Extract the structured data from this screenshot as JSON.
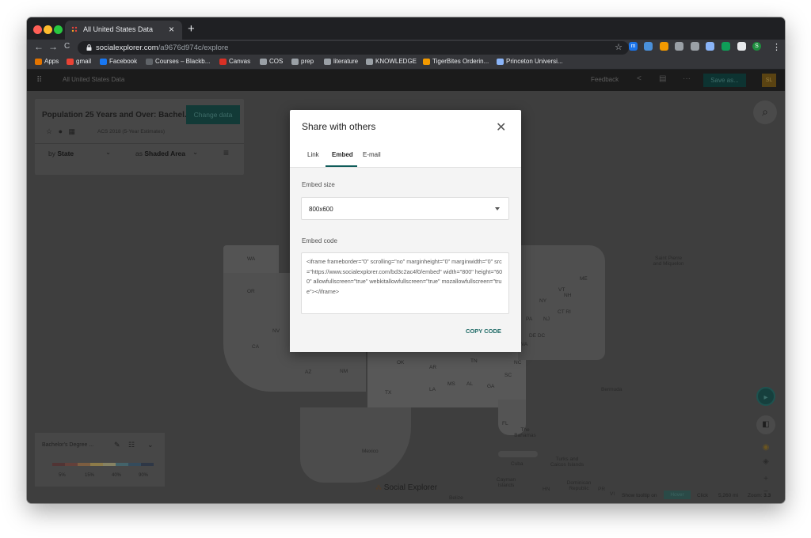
{
  "browser": {
    "tab_title": "All United States Data",
    "tab_close": "×",
    "new_tab": "+",
    "url_host": "socialexplorer.com",
    "url_path": "/a9676d974c/explore",
    "nav": {
      "back": "←",
      "forward": "→",
      "reload": "C"
    },
    "star": "☆",
    "traffic_colors": [
      "#ff5f57",
      "#febc2e",
      "#28c840"
    ],
    "extensions": [
      {
        "name": "m-extension-icon",
        "color": "#1a73e8",
        "glyph": "m"
      },
      {
        "name": "bookmark-extension-icon",
        "color": "#4a90d9",
        "glyph": ""
      },
      {
        "name": "calendar-extension-icon",
        "color": "#f29900",
        "glyph": ""
      },
      {
        "name": "camera-extension-icon",
        "color": "#9aa0a6",
        "glyph": ""
      },
      {
        "name": "puzzle-extension-icon",
        "color": "#9aa0a6",
        "glyph": ""
      },
      {
        "name": "lookup-extension-icon",
        "color": "#8ab4f8",
        "glyph": ""
      },
      {
        "name": "image-extension-icon",
        "color": "#0f9d58",
        "glyph": ""
      },
      {
        "name": "extensions-icon",
        "color": "#e8eaed",
        "glyph": ""
      },
      {
        "name": "profile-avatar-icon",
        "color": "#1e8e3e",
        "glyph": "S"
      }
    ],
    "menu": "⋮",
    "bookmarks": [
      {
        "label": "Apps",
        "color": "#e37400"
      },
      {
        "label": "gmail",
        "color": "#ea4335"
      },
      {
        "label": "Facebook",
        "color": "#1877f2"
      },
      {
        "label": "Courses – Blackb...",
        "color": "#5f6368"
      },
      {
        "label": "Canvas",
        "color": "#d93025"
      },
      {
        "label": "COS",
        "color": "#9aa0a6"
      },
      {
        "label": "prep",
        "color": "#9aa0a6"
      },
      {
        "label": "literature",
        "color": "#9aa0a6"
      },
      {
        "label": "KNOWLEDGE",
        "color": "#9aa0a6"
      },
      {
        "label": "TigerBites Orderin...",
        "color": "#f29900"
      },
      {
        "label": "Princeton Universi...",
        "color": "#8ab4f8"
      }
    ]
  },
  "app": {
    "title": "All United States Data",
    "feedback": "Feedback",
    "save": "Save as...",
    "user_initials": "SL"
  },
  "panel": {
    "title": "Population 25 Years and Over: Bachel...",
    "change_data": "Change data",
    "survey": "ACS 2018 (5-Year Estimates)",
    "by_prefix": "by",
    "by_value": "State",
    "as_prefix": "as",
    "as_value": "Shaded Area"
  },
  "legend": {
    "title": "Bachelor's Degree ...",
    "ticks": [
      "5%",
      "15%",
      "40%",
      "90%"
    ],
    "colors": [
      "#5a2424",
      "#7a3b30",
      "#a8703a",
      "#c6a64a",
      "#b9b37a",
      "#3f7a86",
      "#244f6e",
      "#1a2a45"
    ]
  },
  "map": {
    "labels": [
      "WA",
      "OR",
      "CA",
      "NV",
      "AZ",
      "NM",
      "TX",
      "OK",
      "AR",
      "LA",
      "MS",
      "AL",
      "GA",
      "TN",
      "NC",
      "SC",
      "FL",
      "VA",
      "PA",
      "NJ",
      "NY",
      "VT",
      "NH",
      "ME",
      "CT RI",
      "DE DC",
      "The Bahamas",
      "Bermuda",
      "Saint Pierre and Miquelon",
      "Mexico",
      "Cuba",
      "Turks and Caicos Islands",
      "Dominican Republic",
      "Cayman Islands",
      "Belize",
      "HN",
      "PR",
      "VI"
    ],
    "logo": "Social Explorer"
  },
  "status": {
    "tooltip_prefix": "Show tooltip on",
    "hover": "Hover",
    "click": "Click",
    "scale": "5,260 mi",
    "zoom_label": "Zoom:",
    "zoom_value": "3.3"
  },
  "modal": {
    "title": "Share with others",
    "tabs": [
      "Link",
      "Embed",
      "E-mail"
    ],
    "active_tab": "Embed",
    "embed_size_label": "Embed size",
    "embed_size_value": "800x600",
    "embed_code_label": "Embed code",
    "embed_code": "<iframe frameborder=\"0\" scrolling=\"no\" marginheight=\"0\" marginwidth=\"0\" src=\"https://www.socialexplorer.com/bd3c2ac4f0/embed\" width=\"800\" height=\"600\" allowfullscreen=\"true\" webkitallowfullscreen=\"true\" mozallowfullscreen=\"true\"></iframe>",
    "copy_button": "COPY CODE",
    "close": "✕"
  }
}
